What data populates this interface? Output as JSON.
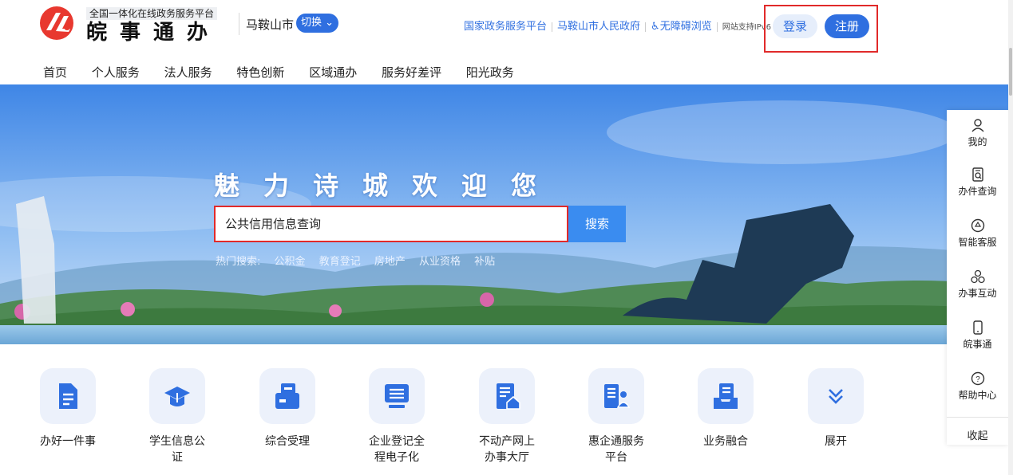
{
  "brand": {
    "subtitle": "全国一体化在线政务服务平台",
    "name": "皖事通办"
  },
  "region": {
    "city": "马鞍山市",
    "switch_label": "切换"
  },
  "top_links": {
    "national": "国家政务服务平台",
    "city_gov": "马鞍山市人民政府",
    "accessibility": "无障碍浏览",
    "ipv6": "网站支持IPv6"
  },
  "auth": {
    "login": "登录",
    "register": "注册"
  },
  "nav": [
    "首页",
    "个人服务",
    "法人服务",
    "特色创新",
    "区域通办",
    "服务好差评",
    "阳光政务"
  ],
  "hero": {
    "title": "魅力诗城欢迎您",
    "search_value": "公共信用信息查询",
    "search_button": "搜索",
    "hot_label": "热门搜索:",
    "hot_items": [
      "公积金",
      "教育登记",
      "房地产",
      "从业资格",
      "补贴"
    ]
  },
  "sidebar": {
    "items": [
      {
        "label": "我的",
        "icon": "user-icon"
      },
      {
        "label": "办件查询",
        "icon": "document-search-icon"
      },
      {
        "label": "智能客服",
        "icon": "robot-icon"
      },
      {
        "label": "办事互动",
        "icon": "interaction-icon"
      },
      {
        "label": "皖事通",
        "icon": "phone-icon"
      },
      {
        "label": "帮助中心",
        "icon": "help-icon"
      }
    ],
    "collapse": "收起"
  },
  "services": [
    {
      "label": "办好一件事",
      "icon": "file-icon"
    },
    {
      "label": "学生信息公证",
      "icon": "graduation-cap-icon"
    },
    {
      "label": "综合受理",
      "icon": "id-card-icon"
    },
    {
      "label": "企业登记全程电子化",
      "icon": "computer-icon"
    },
    {
      "label": "不动产网上办事大厅",
      "icon": "house-document-icon"
    },
    {
      "label": "惠企通服务平台",
      "icon": "enterprise-service-icon"
    },
    {
      "label": "业务融合",
      "icon": "inbox-list-icon"
    },
    {
      "label": "展开",
      "icon": "chevron-double-down-icon"
    }
  ],
  "colors": {
    "primary": "#2f6fe0",
    "highlight_border": "#e12a2a",
    "logo_red": "#e8382f"
  }
}
